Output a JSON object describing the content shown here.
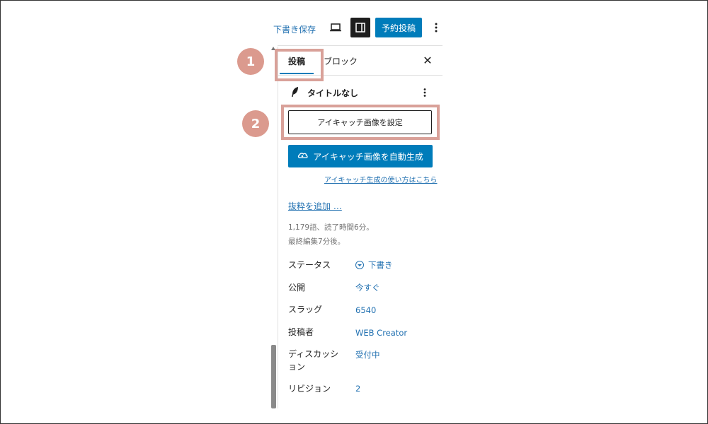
{
  "toolbar": {
    "save_draft": "下書き保存",
    "publish_label": "予約投稿",
    "preview_icon": "laptop-icon",
    "settings_icon": "sidebar-toggle-icon",
    "more_icon": "vertical-ellipsis-icon"
  },
  "tabs": {
    "post": "投稿",
    "block": "ブロック",
    "close": "✕"
  },
  "annotations": {
    "step1": "1",
    "step2": "2"
  },
  "post": {
    "title": "タイトルなし",
    "featured_image_button": "アイキャッチ画像を設定",
    "auto_generate_button": "アイキャッチ画像を自動生成",
    "help_link": "アイキャッチ生成の使い方はこちら",
    "excerpt_link": "抜粋を追加 …",
    "meta_words": "1,179語、読了時間6分。",
    "meta_edited": "最終編集7分後。"
  },
  "settings": [
    {
      "label": "ステータス",
      "value": "下書き"
    },
    {
      "label": "公開",
      "value": "今すぐ"
    },
    {
      "label": "スラッグ",
      "value": "6540"
    },
    {
      "label": "投稿者",
      "value": "WEB Creator"
    },
    {
      "label": "ディスカッション",
      "value": "受付中"
    },
    {
      "label": "リビジョン",
      "value": "2"
    }
  ],
  "colors": {
    "accent": "#007cba",
    "link": "#2271b1",
    "highlight": "#d9a199",
    "badge": "#db9a8e"
  }
}
